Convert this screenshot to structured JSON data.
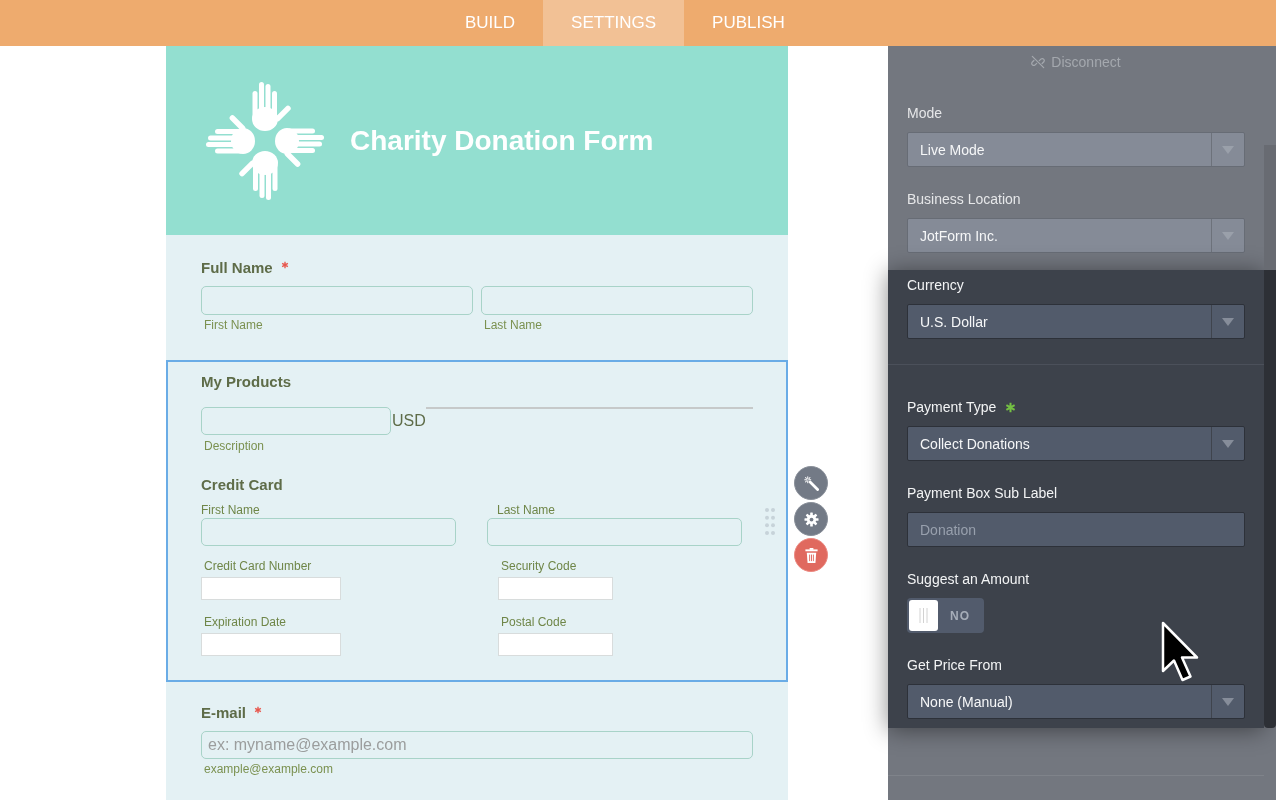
{
  "nav": {
    "tabs": [
      {
        "label": "BUILD",
        "selected": false
      },
      {
        "label": "SETTINGS",
        "selected": true
      },
      {
        "label": "PUBLISH",
        "selected": false
      }
    ]
  },
  "form": {
    "title": "Charity Donation Form",
    "fields": [
      {
        "kind": "full_name",
        "label": "Full Name",
        "required": true,
        "selected": false,
        "sublabels": [
          "First Name",
          "Last Name"
        ]
      },
      {
        "kind": "payment",
        "label": "My Products",
        "required": false,
        "selected": true,
        "product": {
          "currency": "USD",
          "sublabel": "Description"
        },
        "card": {
          "title": "Credit Card",
          "name_labels": [
            "First Name",
            "Last Name"
          ],
          "detail_labels": [
            "Credit Card Number",
            "Security Code",
            "Expiration Date",
            "Postal Code"
          ]
        }
      },
      {
        "kind": "email",
        "label": "E-mail",
        "required": true,
        "selected": false,
        "placeholder": "ex: myname@example.com",
        "sublabel": "example@example.com"
      }
    ]
  },
  "settings": {
    "disconnect": "Disconnect",
    "sections": [
      {
        "items": [
          {
            "kind": "select",
            "label": "Mode",
            "required": false,
            "highlighted": false,
            "value": "Live Mode"
          },
          {
            "kind": "select",
            "label": "Business Location",
            "required": false,
            "highlighted": false,
            "value": "JotForm Inc."
          },
          {
            "kind": "select",
            "label": "Currency",
            "required": false,
            "highlighted": true,
            "value": "U.S. Dollar"
          }
        ]
      },
      {
        "items": [
          {
            "kind": "select",
            "label": "Payment Type",
            "required": true,
            "highlighted": true,
            "value": "Collect Donations"
          },
          {
            "kind": "input",
            "label": "Payment Box Sub Label",
            "required": false,
            "highlighted": true,
            "placeholder": "Donation"
          },
          {
            "kind": "toggle",
            "label": "Suggest an Amount",
            "required": false,
            "highlighted": true,
            "on": false,
            "switch_text": "NO"
          },
          {
            "kind": "select",
            "label": "Get Price From",
            "required": false,
            "highlighted": true,
            "value": "None (Manual)"
          }
        ]
      }
    ]
  }
}
